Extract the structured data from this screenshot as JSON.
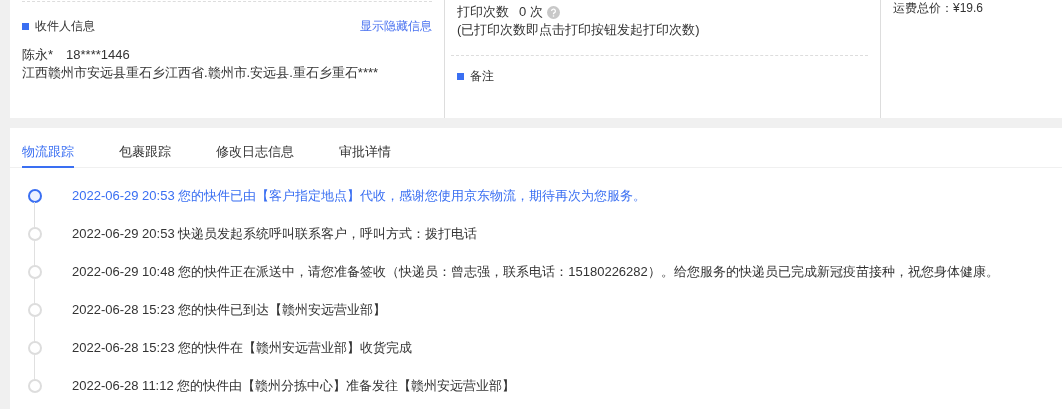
{
  "recipient": {
    "title": "收件人信息",
    "toggle_link": "显示隐藏信息",
    "name_phone": "陈永*　18****1446",
    "address": "江西赣州市安远县重石乡江西省.赣州市.安远县.重石乡重石****"
  },
  "print": {
    "label": "打印次数",
    "count": "0 次",
    "note": "(已打印次数即点击打印按钮发起打印次数)"
  },
  "remarks": {
    "title": "备注"
  },
  "freight": {
    "text": "运费总价：¥19.6"
  },
  "tabs": [
    {
      "label": "物流跟踪",
      "selected": true
    },
    {
      "label": "包裹跟踪",
      "selected": false
    },
    {
      "label": "修改日志信息",
      "selected": false
    },
    {
      "label": "审批详情",
      "selected": false
    }
  ],
  "timeline": [
    {
      "text": "2022-06-29 20:53 您的快件已由【客户指定地点】代收，感谢您使用京东物流，期待再次为您服务。",
      "active": true
    },
    {
      "text": "2022-06-29 20:53 快递员发起系统呼叫联系客户，呼叫方式：拨打电话",
      "active": false
    },
    {
      "text": "2022-06-29 10:48 您的快件正在派送中，请您准备签收（快递员：曾志强，联系电话：15180226282）。给您服务的快递员已完成新冠疫苗接种，祝您身体健康。",
      "active": false
    },
    {
      "text": "2022-06-28 15:23 您的快件已到达【赣州安远营业部】",
      "active": false
    },
    {
      "text": "2022-06-28 15:23 您的快件在【赣州安远营业部】收货完成",
      "active": false
    },
    {
      "text": "2022-06-28 11:12 您的快件由【赣州分拣中心】准备发往【赣州安远营业部】",
      "active": false
    }
  ]
}
